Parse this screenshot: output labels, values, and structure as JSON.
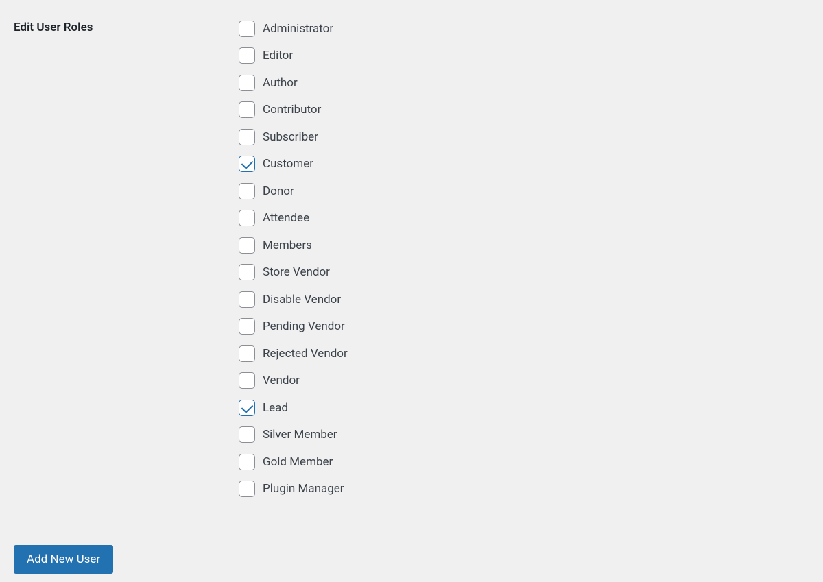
{
  "section": {
    "title": "Edit User Roles"
  },
  "roles": [
    {
      "label": "Administrator",
      "checked": false
    },
    {
      "label": "Editor",
      "checked": false
    },
    {
      "label": "Author",
      "checked": false
    },
    {
      "label": "Contributor",
      "checked": false
    },
    {
      "label": "Subscriber",
      "checked": false
    },
    {
      "label": "Customer",
      "checked": true
    },
    {
      "label": "Donor",
      "checked": false
    },
    {
      "label": "Attendee",
      "checked": false
    },
    {
      "label": "Members",
      "checked": false
    },
    {
      "label": "Store Vendor",
      "checked": false
    },
    {
      "label": "Disable Vendor",
      "checked": false
    },
    {
      "label": "Pending Vendor",
      "checked": false
    },
    {
      "label": "Rejected Vendor",
      "checked": false
    },
    {
      "label": "Vendor",
      "checked": false
    },
    {
      "label": "Lead",
      "checked": true
    },
    {
      "label": "Silver Member",
      "checked": false
    },
    {
      "label": "Gold Member",
      "checked": false
    },
    {
      "label": "Plugin Manager",
      "checked": false
    }
  ],
  "actions": {
    "submit_label": "Add New User"
  }
}
